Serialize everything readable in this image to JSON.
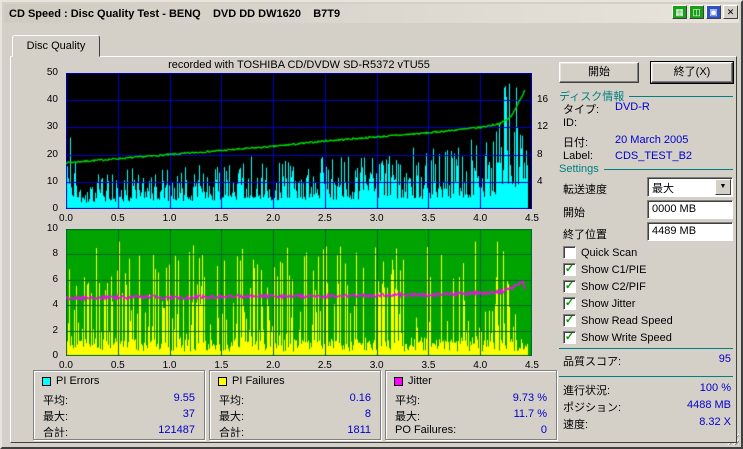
{
  "window": {
    "title": "CD Speed : Disc Quality Test - BENQ    DVD DD DW1620    B7T9",
    "close_glyph": "✕"
  },
  "tab_label": "Disc Quality",
  "chart_header": "recorded with TOSHIBA CD/DVDW SD-R5372 vTU55",
  "actions": {
    "start": "開始",
    "exit": "終了(X)"
  },
  "disc_info": {
    "header": "ディスク情報",
    "type_label": "タイプ:",
    "type_value": "DVD-R",
    "id_label": "ID:",
    "id_value": "",
    "date_label": "日付:",
    "date_value": "20 March 2005",
    "label_label": "Label:",
    "label_value": "CDS_TEST_B2"
  },
  "settings": {
    "header": "Settings",
    "transfer_label": "転送速度",
    "transfer_value": "最大",
    "start_label": "開始",
    "start_value": "0000 MB",
    "end_label": "終了位置",
    "end_value": "4489 MB",
    "checkboxes": [
      {
        "label": "Quick Scan",
        "checked": false
      },
      {
        "label": "Show C1/PIE",
        "checked": true
      },
      {
        "label": "Show C2/PIF",
        "checked": true
      },
      {
        "label": "Show Jitter",
        "checked": true
      },
      {
        "label": "Show Read Speed",
        "checked": true
      },
      {
        "label": "Show Write Speed",
        "checked": true
      }
    ]
  },
  "quality_score": {
    "label": "品質スコア:",
    "value": "95"
  },
  "progress": {
    "status_label": "進行状況:",
    "status_value": "100 %",
    "position_label": "ポジション:",
    "position_value": "4488 MB",
    "speed_label": "速度:",
    "speed_value": "8.32 X"
  },
  "stats": [
    {
      "name": "PI Errors",
      "swatch": "#00ffff",
      "rows": [
        [
          "平均:",
          "9.55"
        ],
        [
          "最大:",
          "37"
        ],
        [
          "合計:",
          "121487"
        ]
      ]
    },
    {
      "name": "PI Failures",
      "swatch": "#ffff00",
      "rows": [
        [
          "平均:",
          "0.16"
        ],
        [
          "最大:",
          "8"
        ],
        [
          "合計:",
          "1811"
        ]
      ]
    },
    {
      "name": "Jitter",
      "swatch": "#ff00ff",
      "rows": [
        [
          "平均:",
          "9.73 %"
        ],
        [
          "最大:",
          "11.7 %"
        ],
        [
          "PO Failures:",
          "0"
        ]
      ]
    }
  ],
  "chart_data": [
    {
      "type": "area",
      "name": "PI Errors and Write Speed",
      "bg": "#000000",
      "grid": "#0000c8",
      "x_range": [
        0,
        4.5
      ],
      "x_unit": "GB",
      "x_ticks": [
        "0.0",
        "0.5",
        "1.0",
        "1.5",
        "2.0",
        "2.5",
        "3.0",
        "3.5",
        "4.0",
        "4.5"
      ],
      "y_left": {
        "range": [
          0,
          50
        ],
        "ticks": [
          50,
          40,
          30,
          20,
          10,
          0
        ]
      },
      "y_right": {
        "range": [
          0,
          20
        ],
        "ticks": [
          16,
          12,
          8,
          4
        ]
      },
      "series": [
        {
          "name": "PI Errors",
          "color": "#00ffff",
          "style": "spiky_area",
          "avg": 9.55,
          "max": 37,
          "total": 121487,
          "envelope": [
            [
              0,
              14
            ],
            [
              0.05,
              30
            ],
            [
              0.12,
              10
            ],
            [
              0.5,
              14
            ],
            [
              1,
              16
            ],
            [
              1.5,
              17
            ],
            [
              2,
              18
            ],
            [
              2.5,
              19
            ],
            [
              3,
              20
            ],
            [
              3.5,
              21
            ],
            [
              4,
              24
            ],
            [
              4.15,
              28
            ],
            [
              4.25,
              50
            ],
            [
              4.32,
              50
            ],
            [
              4.38,
              32
            ],
            [
              4.46,
              26
            ]
          ]
        },
        {
          "name": "Write Speed",
          "color": "#00dc00",
          "style": "line",
          "points": [
            [
              0,
              17
            ],
            [
              0.5,
              18.5
            ],
            [
              1,
              20
            ],
            [
              1.5,
              21.5
            ],
            [
              2,
              23
            ],
            [
              2.5,
              25
            ],
            [
              3,
              26.5
            ],
            [
              3.5,
              28
            ],
            [
              4,
              30
            ],
            [
              4.2,
              31.5
            ],
            [
              4.3,
              34
            ],
            [
              4.38,
              40
            ],
            [
              4.44,
              44
            ]
          ]
        }
      ]
    },
    {
      "type": "bar+line",
      "name": "PI Failures and Jitter",
      "bg": "#00a400",
      "grid": "#006432",
      "x_range": [
        0,
        4.5
      ],
      "x_unit": "GB",
      "x_ticks": [
        "0.0",
        "0.5",
        "1.0",
        "1.5",
        "2.0",
        "2.5",
        "3.0",
        "3.5",
        "4.0",
        "4.5"
      ],
      "y_left": {
        "range": [
          0,
          10
        ],
        "ticks": [
          10,
          8,
          6,
          4,
          2,
          0
        ]
      },
      "series": [
        {
          "name": "PI Failures",
          "color": "#ffff00",
          "style": "spiky_bars",
          "avg": 0.16,
          "max": 8,
          "total": 1811,
          "spike_max": 9
        },
        {
          "name": "Jitter",
          "color": "#ff00ff",
          "style": "line",
          "avg_pct": 9.73,
          "max_pct": 11.7,
          "points": [
            [
              0,
              4.55
            ],
            [
              0.5,
              4.6
            ],
            [
              1,
              4.62
            ],
            [
              1.5,
              4.65
            ],
            [
              2,
              4.7
            ],
            [
              2.5,
              4.72
            ],
            [
              3,
              4.78
            ],
            [
              3.5,
              4.82
            ],
            [
              4,
              4.95
            ],
            [
              4.2,
              5.05
            ],
            [
              4.35,
              5.5
            ],
            [
              4.4,
              5.9
            ],
            [
              4.45,
              5.2
            ]
          ]
        }
      ]
    }
  ]
}
